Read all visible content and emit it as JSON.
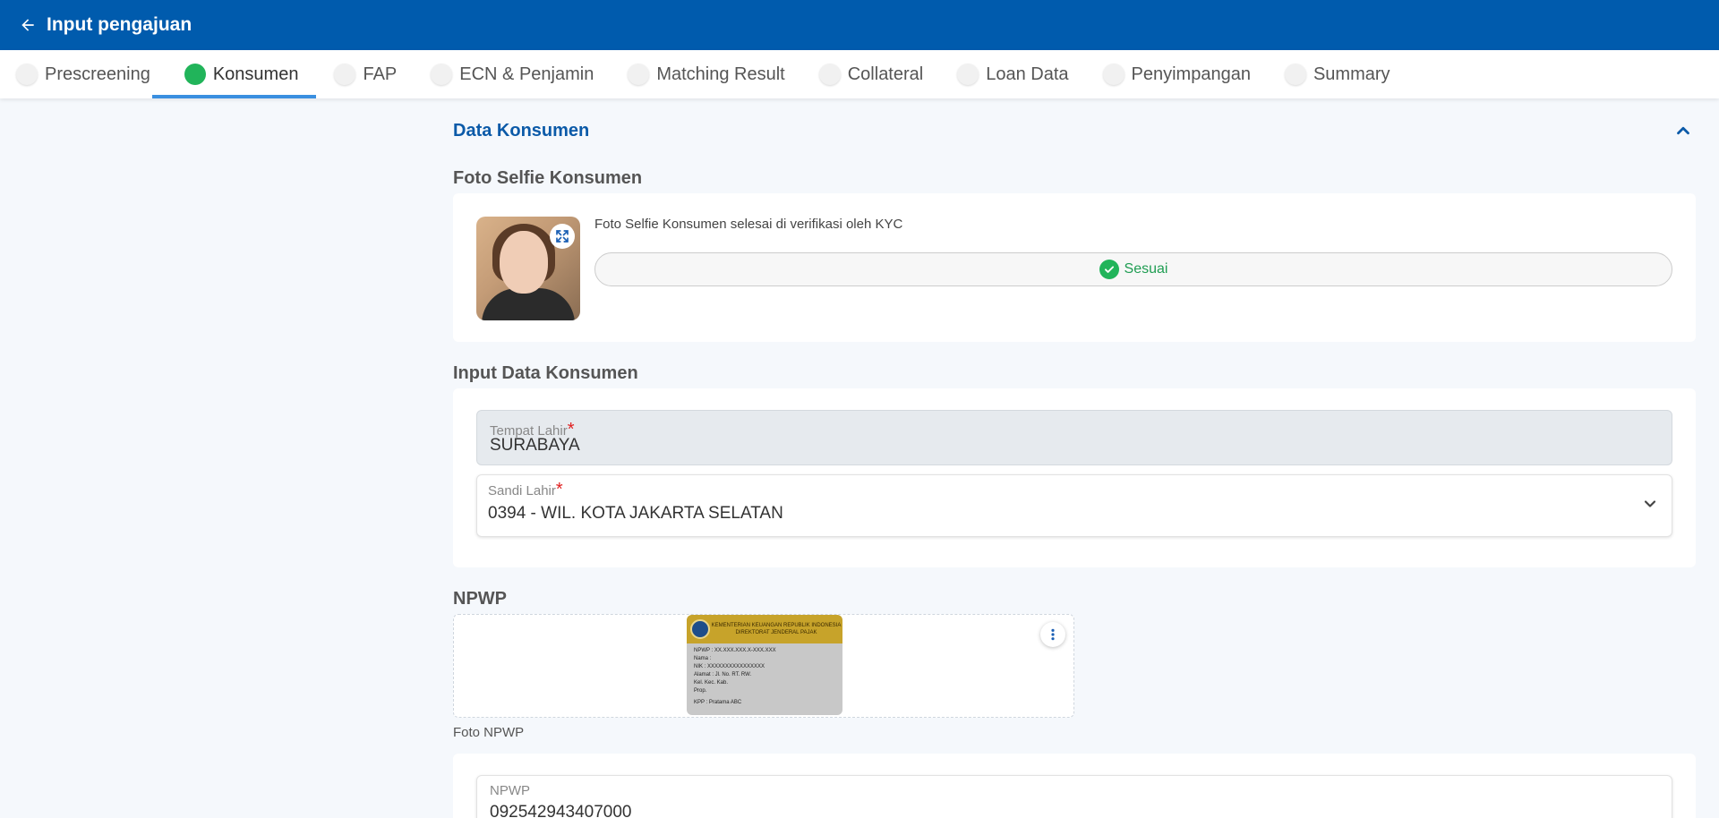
{
  "header": {
    "title": "Input pengajuan"
  },
  "tabs": [
    {
      "label": "Prescreening",
      "active": false
    },
    {
      "label": "Konsumen",
      "active": true
    },
    {
      "label": "FAP",
      "active": false
    },
    {
      "label": "ECN & Penjamin",
      "active": false
    },
    {
      "label": "Matching Result",
      "active": false
    },
    {
      "label": "Collateral",
      "active": false
    },
    {
      "label": "Loan Data",
      "active": false
    },
    {
      "label": "Penyimpangan",
      "active": false
    },
    {
      "label": "Summary",
      "active": false
    }
  ],
  "section": {
    "title": "Data Konsumen"
  },
  "selfie": {
    "heading": "Foto Selfie Konsumen",
    "verification_text": "Foto Selfie Konsumen selesai di verifikasi oleh KYC",
    "status": "Sesuai",
    "status_color": "#21b45a"
  },
  "input_data": {
    "heading": "Input Data Konsumen",
    "tempat_lahir": {
      "label": "Tempat Lahir",
      "required_mark": "*",
      "value": "SURABAYA"
    },
    "sandi_lahir": {
      "label": "Sandi Lahir",
      "required_mark": "*",
      "value": "0394 - WIL. KOTA JAKARTA SELATAN"
    }
  },
  "npwp": {
    "heading": "NPWP",
    "photo_caption": "Foto NPWP",
    "card": {
      "header_line1": "KEMENTERIAN KEUANGAN REPUBLIK INDONESIA",
      "header_line2": "DIREKTORAT JENDERAL PAJAK",
      "line_npwp": "NPWP :  XX.XXX.XXX.X-XXX.XXX",
      "line_nama": "Nama :",
      "line_nik": "NIK   :  XXXXXXXXXXXXXXXX",
      "line_alamat": "Alamat : Jl.              No.       RT.  RW.",
      "line_kel": "Kel.                  Kec.                 Kab.",
      "line_prop": "Prop.",
      "line_kpp": "KPP   :  Pratama ABC"
    },
    "field": {
      "label": "NPWP",
      "value": "092542943407000"
    }
  },
  "colors": {
    "appbar": "#005bad",
    "accent_blue": "#0b5aa8",
    "tab_underline": "#3a8fe0",
    "required": "#e02020"
  }
}
